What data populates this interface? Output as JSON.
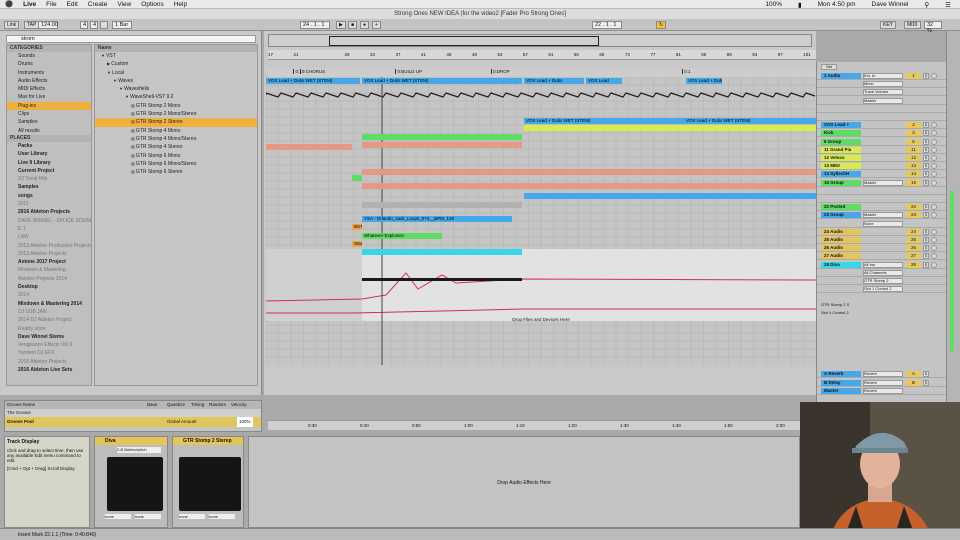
{
  "menubar": {
    "apple": "",
    "app": "Live",
    "items": [
      "File",
      "Edit",
      "Create",
      "View",
      "Options",
      "Help"
    ],
    "battery": "100%",
    "clock": "Mon 4:50 pm",
    "user": "Dave Winnel"
  },
  "window_title": "Strong Ones NEW IDEA (for the video2  [Fader Pro Strong Ones]",
  "transport": {
    "link": "Link",
    "tap": "TAP",
    "tempo": "124.00",
    "time_sig_num": "4",
    "time_sig_den": "4",
    "quantize": "1 Bar",
    "position": "24 . 1 . 1",
    "loop_start": "22 . 1 . 1",
    "key": "KEY",
    "midi": "MIDI",
    "cpu": "32 %"
  },
  "browser": {
    "search_value": "strom",
    "categories_header": "CATEGORIES",
    "categories": [
      "Sounds",
      "Drums",
      "Instruments",
      "Audio Effects",
      "MIDI Effects",
      "Max for Live",
      "Plug-ins",
      "Clips",
      "Samples",
      "All results"
    ],
    "selected_category": "Plug-ins",
    "places_header": "PLACES",
    "places": [
      "Packs",
      "User Library",
      "Live 9 Library",
      "Current Project",
      "X2 Tonal Hits",
      "Samples",
      "songs",
      "2011",
      "2016 Ableton Projects",
      "DAVE WINNEL - SPLICE SOUNDS...",
      "E.T.",
      "LAW",
      "2013 Ableton Production Projects",
      "2013 Ableton Projects",
      "Axtone 2017 Project",
      "Mixdown & Mastering",
      "Ableton Projects 2014",
      "Desktop",
      "2014",
      "Mixdown & Mastering 2014",
      "DJ USB JAN",
      "2014 DJ Ableton Project",
      "Reality store",
      "Dave Winnel Stems",
      "Vengeance Effects Vol 3",
      "Yarstein DJ EFX",
      "2015 Ableton Projects",
      "2016 Ableton Live Sets"
    ],
    "name_header": "Name",
    "files": [
      {
        "label": "VST",
        "indent": 1,
        "arrow": "▼"
      },
      {
        "label": "Custom",
        "indent": 2,
        "arrow": "▶"
      },
      {
        "label": "Local",
        "indent": 2,
        "arrow": "▼"
      },
      {
        "label": "Waves",
        "indent": 3,
        "arrow": "▼"
      },
      {
        "label": "Wavesfiells",
        "indent": 4,
        "arrow": "▼"
      },
      {
        "label": "WaveShell-VST 9.2",
        "indent": 5,
        "arrow": "▼"
      },
      {
        "label": "GTR Stomp 2 Mono",
        "indent": 6,
        "arrow": ""
      },
      {
        "label": "GTR Stomp 2 Mono/Stereo",
        "indent": 6,
        "arrow": ""
      },
      {
        "label": "GTR Stomp 2 Stereo",
        "indent": 6,
        "arrow": "",
        "selected": true
      },
      {
        "label": "GTR Stomp 4 Mono",
        "indent": 6,
        "arrow": ""
      },
      {
        "label": "GTR Stomp 4 Mono/Stereo",
        "indent": 6,
        "arrow": ""
      },
      {
        "label": "GTR Stomp 4 Stereo",
        "indent": 6,
        "arrow": ""
      },
      {
        "label": "GTR Stomp 6 Mono",
        "indent": 6,
        "arrow": ""
      },
      {
        "label": "GTR Stomp 6 Mono/Stereo",
        "indent": 6,
        "arrow": ""
      },
      {
        "label": "GTR Stomp 6 Stereo",
        "indent": 6,
        "arrow": ""
      }
    ]
  },
  "groove": {
    "col_name": "Groove Name",
    "col_base": "Base",
    "col_quantize": "Quantize",
    "col_timing": "Timing",
    "col_random": "Random",
    "col_velocity": "Velocity",
    "row_name": "The Groove",
    "pool_label": "Groove Pool",
    "global_amount_label": "Global Amount",
    "global_amount_value": "100%"
  },
  "info_view": {
    "title": "Track Display",
    "body": "Click and drag to select time, then use any available Edit menu command to edit.",
    "shortcut": "[Cmd + Opt + Drag] Scroll Display"
  },
  "devices": [
    {
      "name": "Diva",
      "preset": "2-B Butterz/pitch",
      "sel_a": "none",
      "sel_b": "none"
    },
    {
      "name": "GTR Stomp 2 Sterep",
      "preset": "",
      "sel_a": "none",
      "sel_b": "none"
    }
  ],
  "drop_fx": "Drop Audio Effects Here",
  "drop_files": "Drop Files and Devices Here",
  "status": "Insert Mark 22.1.1 (Time: 0:40:840)",
  "arrangement": {
    "bar_numbers": [
      "17",
      "",
      "21",
      "",
      "",
      "",
      "29",
      "",
      "33",
      "",
      "37",
      "",
      "41",
      "",
      "45",
      "",
      "49",
      "",
      "53",
      "",
      "57",
      "",
      "61",
      "",
      "65",
      "",
      "69",
      "",
      "73",
      "",
      "77",
      "",
      "81",
      "",
      "85",
      "",
      "89",
      "",
      "93",
      "",
      "97",
      "",
      "101"
    ],
    "locators": [
      {
        "label": "0:1",
        "bar": 21
      },
      {
        "label": "0:CHORUS",
        "bar": 22
      },
      {
        "label": "0:BUILD UP",
        "bar": 37
      },
      {
        "label": "0:DROP",
        "bar": 52
      },
      {
        "label": "0:1",
        "bar": 82
      }
    ],
    "time_labels": [
      "0:30",
      "0:40",
      "0:50",
      "1:00",
      "1:10",
      "1:20",
      "1:30",
      "1:40",
      "1:50",
      "2:00"
    ],
    "clip_labels": {
      "vox_lead": "VOX Lead + Dubs WET (STEM)",
      "vox_lead_short": "VOX Lead + Dubs",
      "vox_lead_cut": "VOX Lead",
      "orlando": "YSA - Orlando_Jack_Loops_074__BPM_128",
      "whatever": "Whatever Explosion",
      "bst": "BST",
      "star": "Star"
    }
  },
  "mixer": {
    "set_label": "Set",
    "tracks": [
      {
        "name": "1 Audio",
        "color": "#46a8e8",
        "num": "1",
        "sel": "Ext. In"
      },
      {
        "name": "",
        "color": "",
        "num": "",
        "sel": "Mixer"
      },
      {
        "name": "",
        "color": "",
        "num": "",
        "sel": "Track Volume"
      },
      {
        "name": "",
        "color": "",
        "num": "",
        "sel": "Master"
      },
      {
        "name": "",
        "color": "",
        "num": "",
        "sel": ""
      },
      {
        "name": "",
        "color": "",
        "num": "",
        "sel": ""
      },
      {
        "name": "VOX Lead +",
        "color": "#46a8e8",
        "num": "2",
        "sel": ""
      },
      {
        "name": "Kick",
        "color": "#5fdc63",
        "num": "3",
        "sel": ""
      },
      {
        "name": "6 Group",
        "color": "#5fdc63",
        "num": "6",
        "sel": ""
      },
      {
        "name": "11 Grand Pia",
        "color": "#d9ec4b",
        "num": "11",
        "sel": ""
      },
      {
        "name": "12 Velocs",
        "color": "#d9ec4b",
        "num": "12",
        "sel": ""
      },
      {
        "name": "13 MIDI",
        "color": "#d9ec4b",
        "num": "13",
        "sel": ""
      },
      {
        "name": "14 SyllechH",
        "color": "#46a8e8",
        "num": "14",
        "sel": ""
      },
      {
        "name": "15 Group",
        "color": "#5fdc63",
        "num": "15",
        "sel": "Master"
      },
      {
        "name": "",
        "color": "",
        "num": "",
        "sel": ""
      },
      {
        "name": "",
        "color": "",
        "num": "",
        "sel": ""
      },
      {
        "name": "22 Posted",
        "color": "#5fdc63",
        "num": "22",
        "sel": ""
      },
      {
        "name": "23 Group",
        "color": "#46a8e8",
        "num": "23",
        "sel": "Master"
      },
      {
        "name": "",
        "color": "",
        "num": "",
        "sel": "None"
      },
      {
        "name": "24 Audio",
        "color": "#e5c45a",
        "num": "24",
        "sel": ""
      },
      {
        "name": "25 Audio",
        "color": "#e5c45a",
        "num": "25",
        "sel": ""
      },
      {
        "name": "26 Audio",
        "color": "#e5c45a",
        "num": "26",
        "sel": ""
      },
      {
        "name": "27 Audio",
        "color": "#e5c45a",
        "num": "27",
        "sel": ""
      },
      {
        "name": "28 Diva",
        "color": "#38d6e8",
        "num": "28",
        "sel": "All Ins"
      },
      {
        "name": "",
        "color": "",
        "num": "",
        "sel": "All Channels"
      },
      {
        "name": "",
        "color": "",
        "num": "",
        "sel": "GTR Stomp 2"
      },
      {
        "name": "",
        "color": "",
        "num": "",
        "sel": "Slot 1 Control 2"
      }
    ],
    "auto_label": "Auto",
    "in_label": "In",
    "off_label": "Off",
    "device_param_1": "GTR Stomp 2 S",
    "device_param_2": "Slot 1 Control 2",
    "returns": [
      {
        "name": "A Reverb",
        "color": "#46a8e8",
        "num": "A"
      },
      {
        "name": "B Delay",
        "color": "#46a8e8",
        "num": "B"
      },
      {
        "name": "Master",
        "color": "#46a8e8",
        "num": ""
      }
    ],
    "return_sel": "Reverb"
  },
  "colors": {
    "selection": "#f0b040",
    "clip_blue": "#46a8e8",
    "clip_salmon": "#e29a82",
    "clip_green": "#5fdc63",
    "clip_lime": "#d9ec4b",
    "clip_cyan": "#38d6e8",
    "automation": "#d6276a"
  }
}
